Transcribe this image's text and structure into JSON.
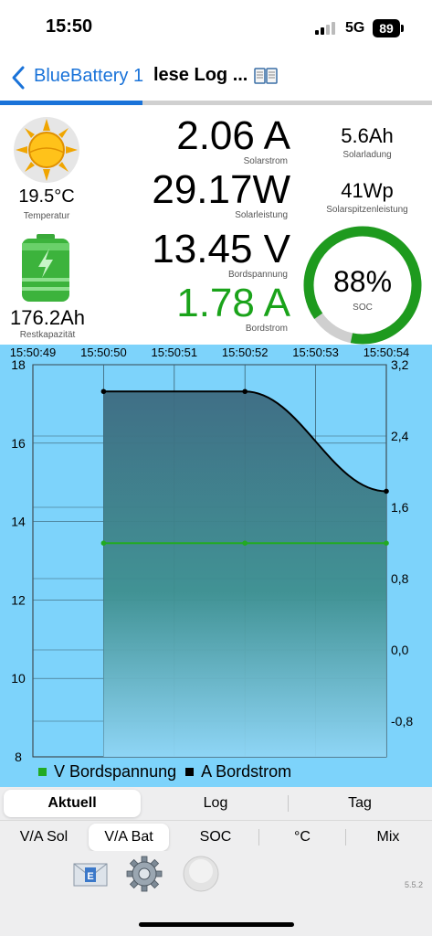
{
  "status_bar": {
    "time": "15:50",
    "network": "5G",
    "battery": "89"
  },
  "nav": {
    "back_label": "BlueBattery 1",
    "title": "lese Log ...",
    "book_icon": "book-icon",
    "load_progress": 0.33
  },
  "left": {
    "temperature_value": "19.5°C",
    "temperature_label": "Temperatur",
    "capacity_value": "176.2Ah",
    "capacity_label": "Restkapazität"
  },
  "metrics": {
    "solar_current": "2.06 A",
    "solar_current_label": "Solarstrom",
    "solar_power": "29.17W",
    "solar_power_label": "Solarleistung",
    "board_voltage": "13.45 V",
    "board_voltage_label": "Bordspannung",
    "board_current": "1.78 A",
    "board_current_label": "Bordstrom"
  },
  "side": {
    "solar_charge": "5.6Ah",
    "solar_charge_label": "Solarladung",
    "solar_peak": "41Wp",
    "solar_peak_label": "Solarspitzenleistung"
  },
  "soc": {
    "value": "88%",
    "label": "SOC",
    "percent": 88
  },
  "colors": {
    "accent": "#1a73d9",
    "green": "#1aa31a",
    "chart_bg": "#7dd3fb"
  },
  "chart_data": {
    "type": "line",
    "x": [
      "15:50:49",
      "15:50:50",
      "15:50:51",
      "15:50:52",
      "15:50:53",
      "15:50:54"
    ],
    "y_left_ticks": [
      "18",
      "16",
      "14",
      "12",
      "10",
      "8"
    ],
    "y_right_ticks": [
      "3,2",
      "2,4",
      "1,6",
      "0,8",
      "0,0",
      "-0,8"
    ],
    "ylim_left": [
      8,
      18
    ],
    "ylim_right": [
      -1.2,
      3.2
    ],
    "series": [
      {
        "name": "V Bordspannung",
        "axis": "left",
        "color": "#22aa22",
        "x": [
          "15:50:50",
          "15:50:52",
          "15:50:54"
        ],
        "values": [
          13.45,
          13.45,
          13.45
        ]
      },
      {
        "name": "A Bordstrom",
        "axis": "right",
        "color": "#000000",
        "x": [
          "15:50:50",
          "15:50:52",
          "15:50:54"
        ],
        "values": [
          2.9,
          2.9,
          1.78
        ]
      }
    ],
    "grid": true,
    "legend_position": "bottom"
  },
  "tabs_top": [
    "Aktuell",
    "Log",
    "Tag"
  ],
  "tabs_bottom": [
    "V/A Sol",
    "V/A Bat",
    "SOC",
    "°C",
    "Mix"
  ],
  "footer": {
    "version": "5.5.2"
  }
}
